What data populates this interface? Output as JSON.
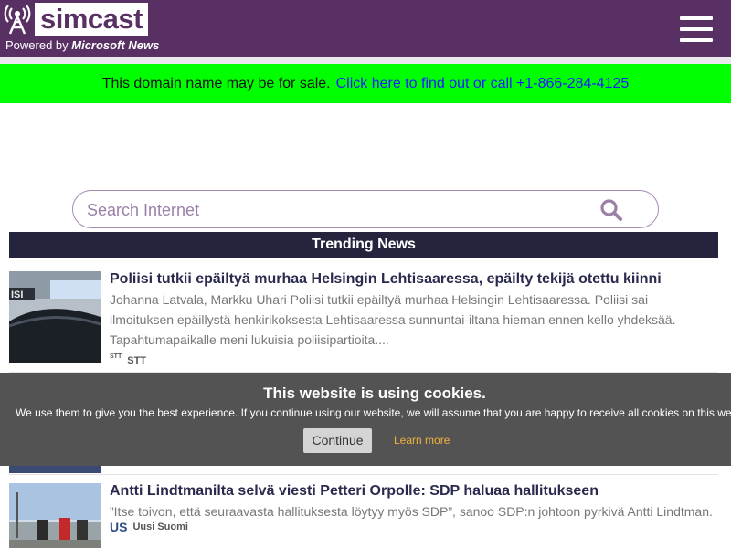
{
  "header": {
    "logo_text": "simcast",
    "powered_prefix": "Powered by ",
    "powered_brand": "Microsoft News",
    "bg_color": "#583064"
  },
  "sale_banner": {
    "text": "This domain name may be for sale.",
    "link": "Click here to find out or call +1-866-284-4125",
    "bg_color": "#00ff00"
  },
  "search": {
    "placeholder": "Search Internet"
  },
  "trending": {
    "title": "Trending News"
  },
  "articles": [
    {
      "title": "Poliisi tutkii epäiltyä murhaa Helsingin Lehtisaaressa, epäilty tekijä otettu kiinni",
      "description": "Johanna Latvala, Markku Uhari Poliisi tutkii epäiltyä murhaa Helsingin Lehtisaaressa. Poliisi sai ilmoituksen epäillystä henkirikoksesta Lehtisaaressa sunnuntai-iltana hieman ennen kello yhdeksää. Tapahtumapaikalle meni lukuisia poliisipartioita....",
      "source_logo": "STT",
      "source": "STT"
    },
    {
      "title": "Antti Lindtmanilta selvä viesti Petteri Orpolle: SDP haluaa hallitukseen",
      "description": "”Itse toivon, että seuraavasta hallituksesta löytyy myös SDP”, sanoo SDP:n johtoon pyrkivä Antti Lindtman.",
      "source_logo": "US",
      "source": "Uusi Suomi"
    }
  ],
  "cookie": {
    "title": "This website is using cookies.",
    "text": "We use them to give you the best experience. If you continue using our website, we will assume that you are happy to receive all cookies on this website.",
    "continue_label": "Continue",
    "learn_label": "Learn more"
  }
}
